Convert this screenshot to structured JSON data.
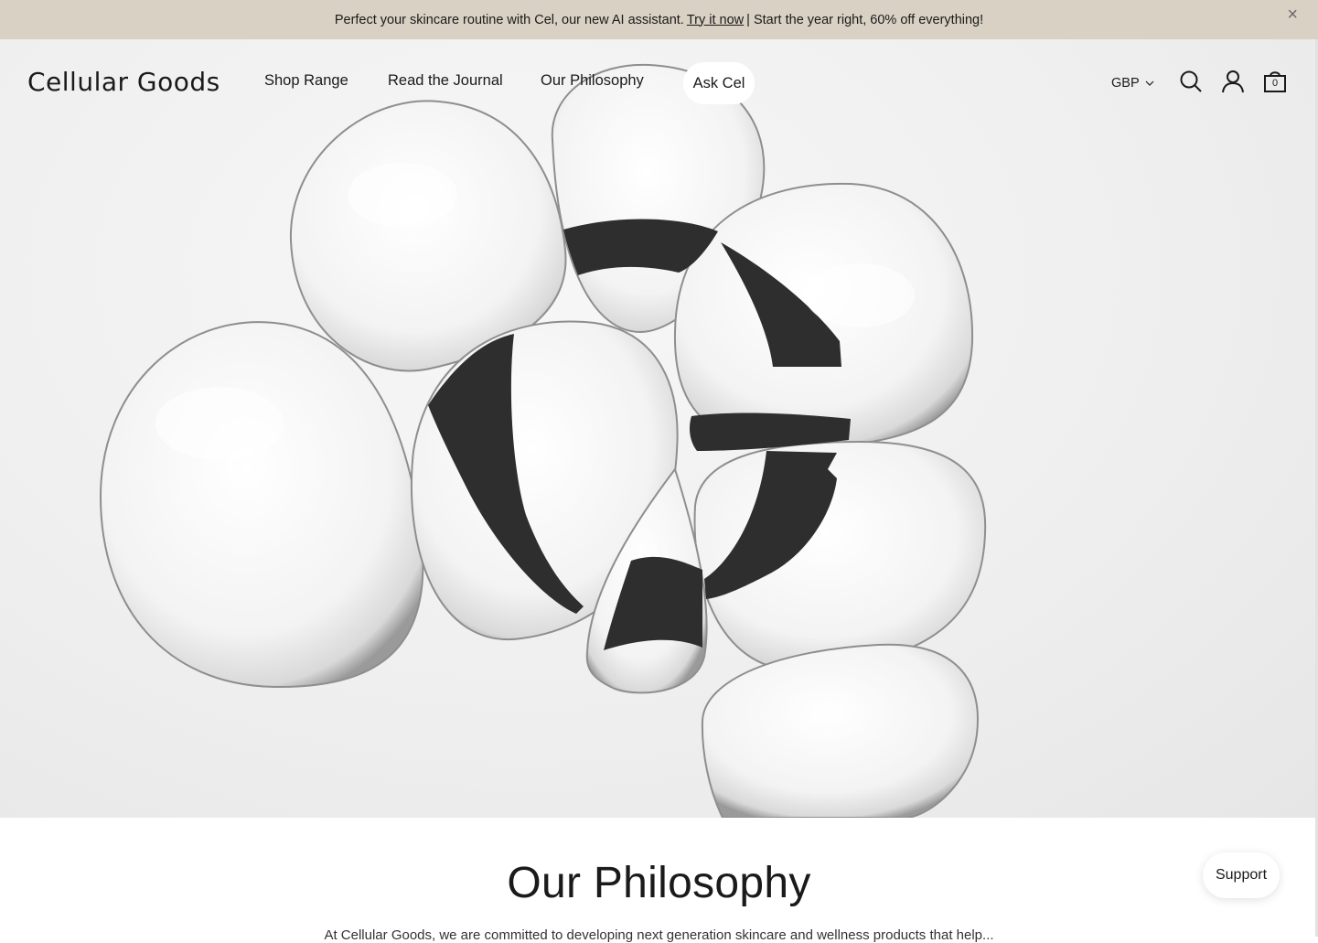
{
  "announcement": {
    "text_before": "Perfect your skincare routine with Cel, our new AI assistant.",
    "link": "Try it now",
    "text_after": "| Start the year right, 60% off everything!",
    "close_icon": "close-icon"
  },
  "header": {
    "logo": "Cellular Goods",
    "nav": [
      "Shop Range",
      "Read the Journal",
      "Our Philosophy"
    ],
    "ask": "Ask Cel",
    "currency": "GBP",
    "cart_count": "0",
    "icons": [
      "search-icon",
      "account-icon",
      "cart-icon"
    ]
  },
  "section": {
    "title": "Our Philosophy",
    "text": "At Cellular Goods, we are committed to developing next generation skincare and wellness products that help..."
  },
  "support": "Support"
}
